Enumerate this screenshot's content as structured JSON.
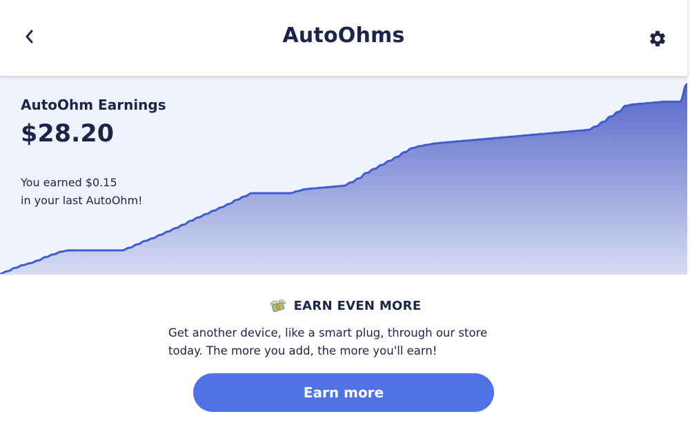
{
  "header": {
    "title": "AutoOhms",
    "back_icon": "chevron-left-icon",
    "settings_icon": "gear-icon"
  },
  "earnings": {
    "label": "AutoOhm Earnings",
    "total": "$28.20",
    "last_message_line1": "You earned $0.15",
    "last_message_line2": "in your last AutoOhm!"
  },
  "chart_data": {
    "type": "area",
    "title": "",
    "xlabel": "",
    "ylabel": "",
    "x": [
      0,
      1,
      2,
      3,
      4,
      5,
      6,
      7,
      8,
      9,
      10,
      11,
      12,
      13,
      14,
      15,
      16,
      17,
      18,
      19,
      20,
      21,
      22,
      23,
      24,
      25,
      26,
      27,
      28,
      29,
      30,
      31,
      32,
      33,
      34,
      35,
      36,
      37,
      38,
      39,
      40,
      41,
      42,
      43,
      44,
      45,
      46,
      47,
      48,
      49,
      50,
      51,
      52,
      53,
      54,
      55,
      56,
      57,
      58,
      59,
      60,
      61,
      62,
      63,
      64,
      65,
      66,
      67,
      68,
      69,
      70,
      71,
      72,
      73,
      74,
      75,
      76,
      77,
      78,
      79,
      80,
      81,
      82,
      83,
      84,
      85,
      86,
      87,
      88,
      89,
      90
    ],
    "series": [
      {
        "values": [
          0.0,
          0.4,
          0.9,
          1.3,
          1.6,
          2.0,
          2.5,
          2.9,
          3.3,
          3.5,
          3.5,
          3.5,
          3.5,
          3.5,
          3.5,
          3.5,
          3.5,
          3.9,
          4.4,
          4.9,
          5.3,
          5.8,
          6.3,
          6.8,
          7.3,
          7.9,
          8.4,
          8.9,
          9.4,
          9.9,
          10.4,
          11.0,
          11.5,
          12.0,
          12.0,
          12.0,
          12.0,
          12.0,
          12.0,
          12.3,
          12.6,
          12.7,
          12.8,
          12.9,
          13.0,
          13.1,
          13.6,
          14.2,
          15.0,
          15.6,
          16.2,
          16.8,
          17.4,
          18.1,
          18.7,
          19.0,
          19.2,
          19.4,
          19.5,
          19.6,
          19.7,
          19.8,
          19.9,
          20.0,
          20.1,
          20.2,
          20.3,
          20.4,
          20.5,
          20.6,
          20.7,
          20.8,
          20.9,
          21.0,
          21.1,
          21.2,
          21.3,
          21.4,
          21.9,
          22.6,
          23.4,
          24.1,
          25.0,
          25.2,
          25.3,
          25.4,
          25.5,
          25.6,
          25.6,
          25.6,
          28.2
        ]
      }
    ],
    "ylim": [
      0,
      28.2
    ],
    "grid": false,
    "legend": "none",
    "colors": {
      "line": "#3f5ccf",
      "fill_top": "#5566c8",
      "fill_bottom": "#d6dcf3"
    }
  },
  "promo": {
    "icon": "money-with-wings-icon",
    "title": "EARN EVEN MORE",
    "text_line1": "Get another device, like a smart plug, through our store",
    "text_line2": "today. The more you add, the more you'll earn!",
    "button_label": "Earn more"
  },
  "colors": {
    "navy": "#1c2447",
    "accent": "#4f73e6",
    "panel_bg": "#eff3fd"
  }
}
